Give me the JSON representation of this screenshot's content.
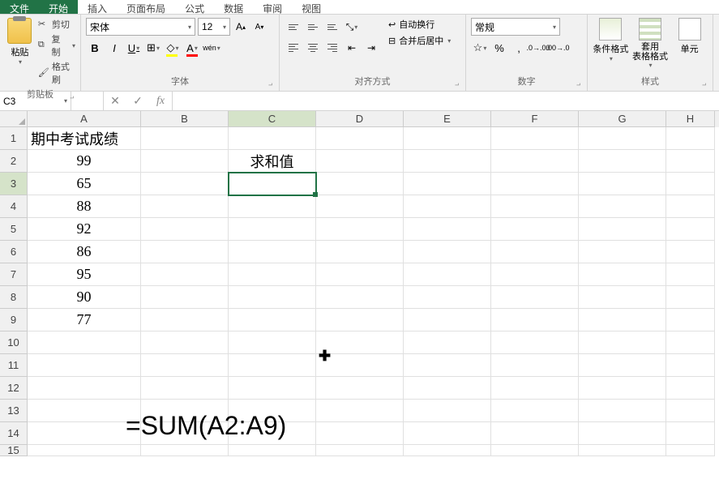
{
  "tabs": {
    "file": "文件",
    "home": "开始",
    "insert": "插入",
    "layout": "页面布局",
    "formulas": "公式",
    "data": "数据",
    "review": "审阅",
    "view": "视图"
  },
  "ribbon": {
    "clipboard": {
      "paste": "粘贴",
      "cut": "剪切",
      "copy": "复制",
      "format_painter": "格式刷",
      "label": "剪贴板"
    },
    "font": {
      "name": "宋体",
      "size": "12",
      "grow": "A",
      "shrink": "A",
      "bold": "B",
      "italic": "I",
      "underline": "U",
      "wen": "wén",
      "label": "字体"
    },
    "alignment": {
      "wrap": "自动换行",
      "merge": "合并后居中",
      "label": "对齐方式"
    },
    "number": {
      "format": "常规",
      "label": "数字"
    },
    "styles": {
      "conditional": "条件格式",
      "table": "套用\n表格格式",
      "cell": "单元",
      "label": "样式"
    }
  },
  "formula_bar": {
    "name_box": "C3",
    "fx": "fx",
    "formula": ""
  },
  "columns": [
    "A",
    "B",
    "C",
    "D",
    "E",
    "F",
    "G",
    "H"
  ],
  "rows": [
    "1",
    "2",
    "3",
    "4",
    "5",
    "6",
    "7",
    "8",
    "9",
    "10",
    "11",
    "12",
    "13",
    "14",
    "15"
  ],
  "cells": {
    "A1": "期中考试成绩",
    "A2": "99",
    "A3": "65",
    "A4": "88",
    "A5": "92",
    "A6": "86",
    "A7": "95",
    "A8": "90",
    "A9": "77",
    "C2": "求和值"
  },
  "selected_cell": "C3",
  "overlay_formula": "=SUM(A2:A9)",
  "chart_data": {
    "type": "table",
    "title": "期中考试成绩",
    "categories": [
      "A2",
      "A3",
      "A4",
      "A5",
      "A6",
      "A7",
      "A8",
      "A9"
    ],
    "values": [
      99,
      65,
      88,
      92,
      86,
      95,
      90,
      77
    ],
    "formula": "=SUM(A2:A9)"
  }
}
